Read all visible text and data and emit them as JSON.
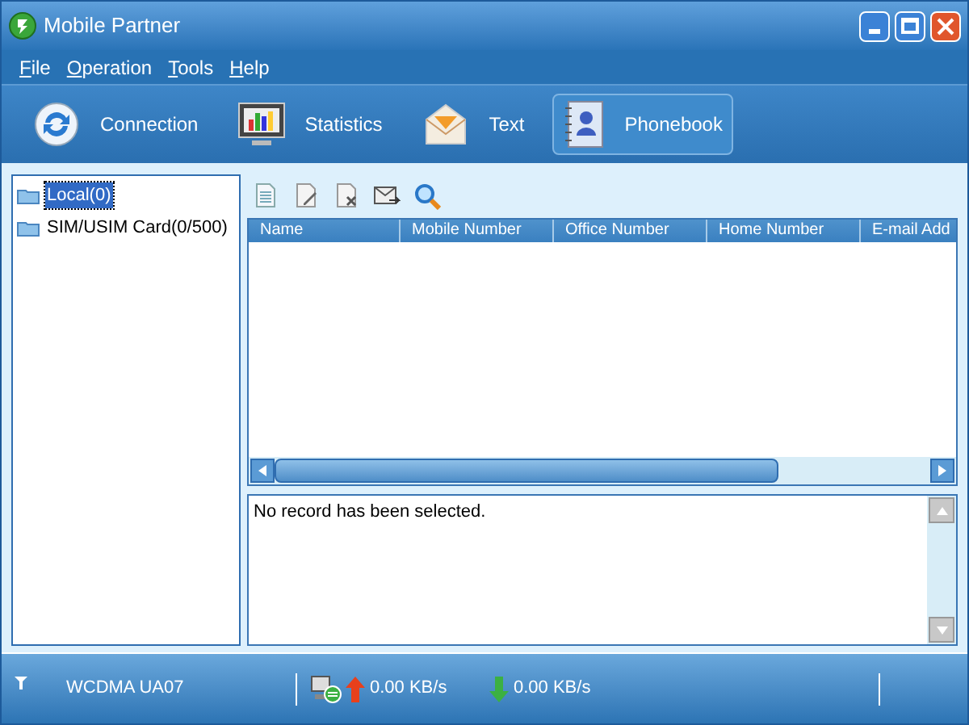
{
  "window": {
    "title": "Mobile Partner"
  },
  "menu": [
    "File",
    "Operation",
    "Tools",
    "Help"
  ],
  "tabs": [
    {
      "label": "Connection",
      "kind": "sync",
      "selected": false
    },
    {
      "label": "Statistics",
      "kind": "monitor",
      "selected": false
    },
    {
      "label": "Text",
      "kind": "envelope",
      "selected": false
    },
    {
      "label": "Phonebook",
      "kind": "book",
      "selected": true
    }
  ],
  "tree": [
    {
      "label": "Local(0)",
      "selected": true
    },
    {
      "label": "SIM/USIM Card(0/500)",
      "selected": false
    }
  ],
  "toolbar": [
    {
      "kind": "new"
    },
    {
      "kind": "edit"
    },
    {
      "kind": "delete"
    },
    {
      "kind": "send"
    },
    {
      "kind": "search"
    }
  ],
  "table": {
    "columns": [
      "Name",
      "Mobile Number",
      "Office Number",
      "Home Number",
      "E-mail Add"
    ]
  },
  "detail": {
    "text": "No record has been selected."
  },
  "status_bar": {
    "network": "WCDMA  UA07",
    "upload": "0.00 KB/s",
    "download": "0.00 KB/s"
  }
}
